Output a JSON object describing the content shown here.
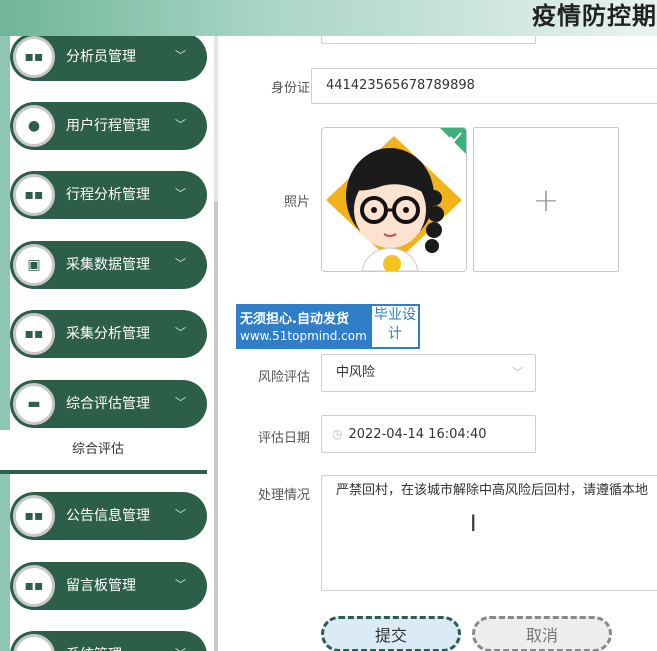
{
  "header": {
    "title": "疫情防控期"
  },
  "sidebar": {
    "items": [
      {
        "label": "分析员管理",
        "icon": "grid-icon"
      },
      {
        "label": "用户行程管理",
        "icon": "user-icon"
      },
      {
        "label": "行程分析管理",
        "icon": "grid-icon"
      },
      {
        "label": "采集数据管理",
        "icon": "clipboard-icon"
      },
      {
        "label": "采集分析管理",
        "icon": "grid-icon"
      },
      {
        "label": "综合评估管理",
        "icon": "monitor-icon"
      },
      {
        "label": "公告信息管理",
        "icon": "grid-icon"
      },
      {
        "label": "留言板管理",
        "icon": "grid-icon"
      },
      {
        "label": "系统管理",
        "icon": "grid-icon"
      }
    ],
    "submenu": {
      "label": "综合评估"
    }
  },
  "form": {
    "id_card": {
      "label": "身份证",
      "value": "441423565678789898"
    },
    "photo": {
      "label": "照片"
    },
    "risk": {
      "label": "风险评估",
      "value": "中风险"
    },
    "date": {
      "label": "评估日期",
      "value": "2022-04-14 16:04:40"
    },
    "handling": {
      "label": "处理情况",
      "value": "严禁回村，在该城市解除中高风险后回村，请遵循本地"
    },
    "submit_label": "提交",
    "cancel_label": "取消"
  },
  "watermark": {
    "line1": "无须担心.自动发货",
    "line2": "www.51topmind.com",
    "side": "毕业设计"
  },
  "colors": {
    "menu": "#2d5e4a",
    "accent": "#2f7ec7"
  }
}
